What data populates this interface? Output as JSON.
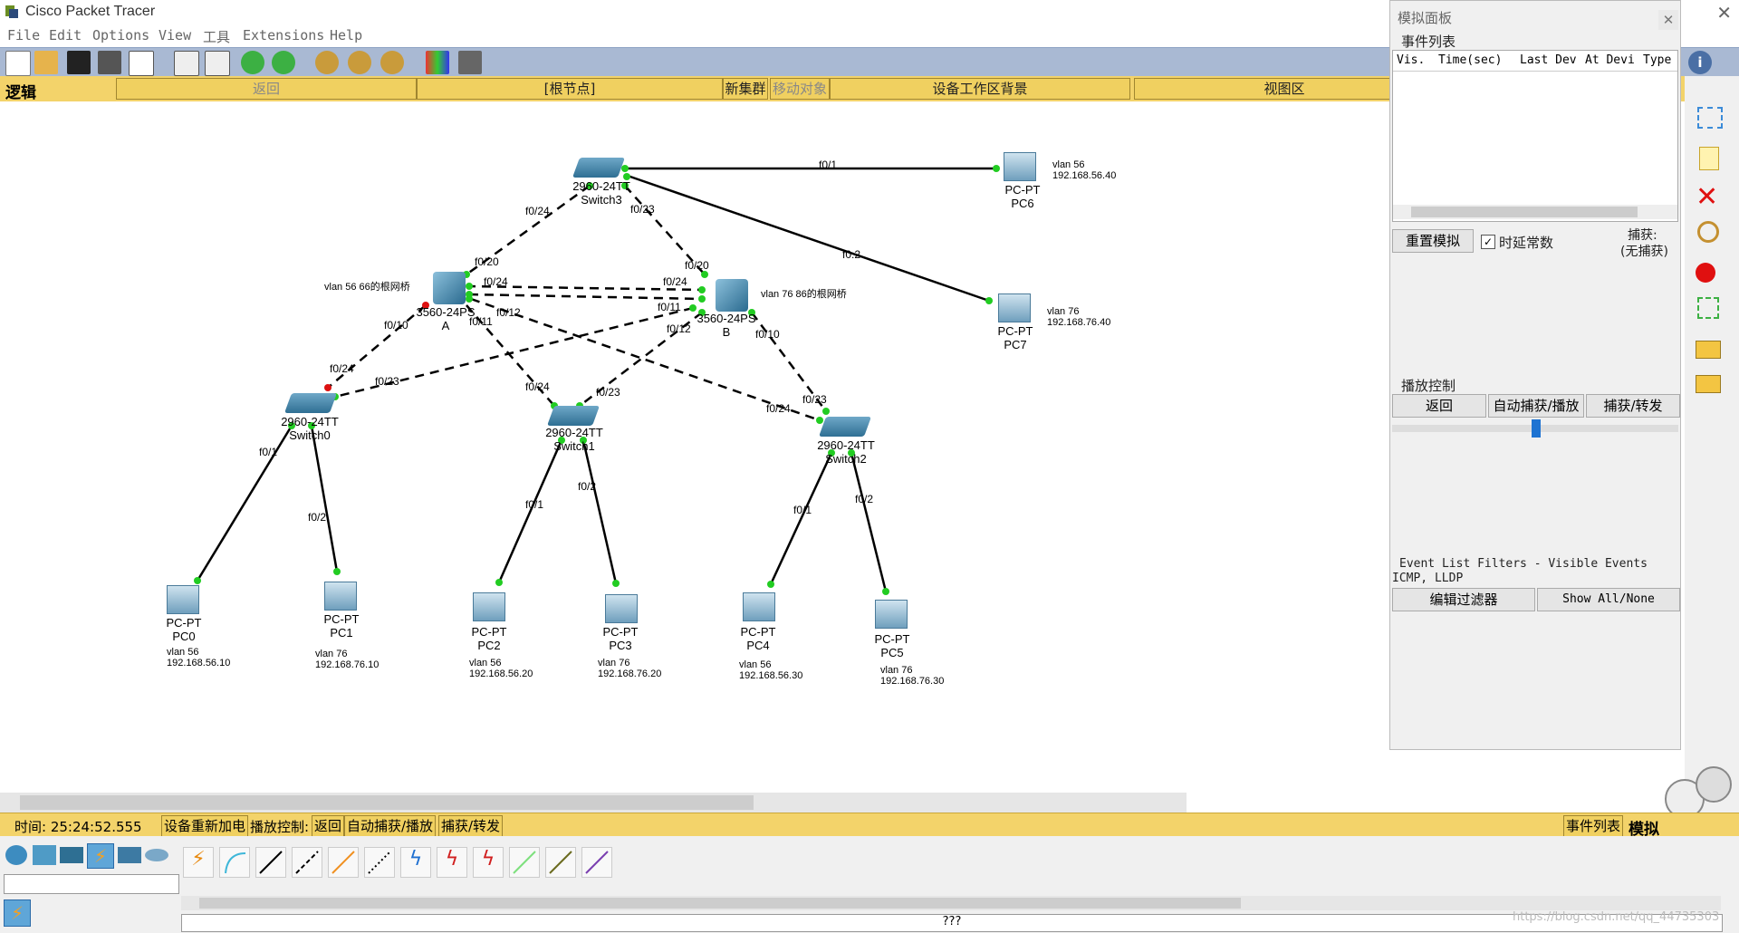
{
  "window": {
    "title": "Cisco Packet Tracer"
  },
  "menu": [
    "File",
    "Edit",
    "Options",
    "View",
    "工具",
    "Extensions",
    "Help"
  ],
  "navbar": {
    "logic": "逻辑",
    "back": "返回",
    "root": "[根节点]",
    "new_cluster": "新集群",
    "move_object": "移动对象",
    "bg": "设备工作区背景",
    "viewport": "视图区"
  },
  "sim_panel": {
    "title": "模拟面板",
    "event_list": "事件列表",
    "columns": [
      "Vis.",
      "Time(sec)",
      "Last Dev",
      "At Devi",
      "Type"
    ],
    "reset": "重置模拟",
    "constant_delay": "时延常数",
    "capture_label": "捕获:",
    "capture_value": "(无捕获)",
    "play_control": "播放控制",
    "btn_back": "返回",
    "btn_auto": "自动捕获/播放",
    "btn_capture": "捕获/转发",
    "filters_title": "Event List Filters - Visible Events",
    "filters_value": "ICMP, LLDP",
    "edit_filter": "编辑过滤器",
    "show_all": "Show All/None"
  },
  "status": {
    "time": "时间: 25:24:52.555",
    "power": "设备重新加电",
    "play": "播放控制:",
    "back": "返回",
    "auto": "自动捕获/播放",
    "capture": "捕获/转发",
    "events": "事件列表",
    "mode": "模拟"
  },
  "bottom": {
    "unknown": "???",
    "watermark": "https://blog.csdn.net/qq_44735303"
  },
  "devices": {
    "switch3": {
      "model": "2960-24TT",
      "name": "Switch3"
    },
    "switch0": {
      "model": "2960-24TT",
      "name": "Switch0"
    },
    "switch1": {
      "model": "2960-24TT",
      "name": "Switch1"
    },
    "switch2": {
      "model": "2960-24TT",
      "name": "Switch2"
    },
    "msA": {
      "model": "3560-24PS",
      "name": "A",
      "note": "vlan 56 66的根网桥"
    },
    "msB": {
      "model": "3560-24PS",
      "name": "B",
      "note": "vlan 76 86的根网桥"
    },
    "pc0": {
      "type": "PC-PT",
      "name": "PC0",
      "vlan": "vlan 56",
      "ip": "192.168.56.10"
    },
    "pc1": {
      "type": "PC-PT",
      "name": "PC1",
      "vlan": "vlan 76",
      "ip": "192.168.76.10"
    },
    "pc2": {
      "type": "PC-PT",
      "name": "PC2",
      "vlan": "vlan 56",
      "ip": "192.168.56.20"
    },
    "pc3": {
      "type": "PC-PT",
      "name": "PC3",
      "vlan": "vlan 76",
      "ip": "192.168.76.20"
    },
    "pc4": {
      "type": "PC-PT",
      "name": "PC4",
      "vlan": "vlan 56",
      "ip": "192.168.56.30"
    },
    "pc5": {
      "type": "PC-PT",
      "name": "PC5",
      "vlan": "vlan 76",
      "ip": "192.168.76.30"
    },
    "pc6": {
      "type": "PC-PT",
      "name": "PC6",
      "vlan": "vlan 56",
      "ip": "192.168.56.40"
    },
    "pc7": {
      "type": "PC-PT",
      "name": "PC7",
      "vlan": "vlan 76",
      "ip": "192.168.76.40"
    }
  },
  "ports": {
    "s3_pc6": "f0/1",
    "s3_pc7": "f0.2",
    "s3_a": "f0/24",
    "s3_b": "f0/23",
    "a_s3": "f0/20",
    "b_s3": "f0/20",
    "a_b1": "f0/24",
    "b_a1": "f0/24",
    "a_b2": "f0/11",
    "a_s0": "f0/10",
    "a_s1": "f0/11",
    "a_s2": "f0/12",
    "b_s0": "f0/11",
    "b_s1": "f0/12",
    "b_s2": "f0/10",
    "s0_a": "f0/24",
    "s0_b": "f0/23",
    "s1_a": "f0/24",
    "s1_b": "f0/23",
    "s2_b": "f0/23",
    "s2_a": "f0/24",
    "s0_pc0": "f0/1",
    "s0_pc1": "f0/2",
    "s1_pc2": "f0/1",
    "s1_pc3": "f0/2",
    "s2_pc4": "f0/1",
    "s2_pc5": "f0/2"
  },
  "colors": {
    "toolbar": "#a9b9d3",
    "yellow": "#f3d36a",
    "link_green": "#22cc22",
    "link_red": "#dd1111"
  }
}
